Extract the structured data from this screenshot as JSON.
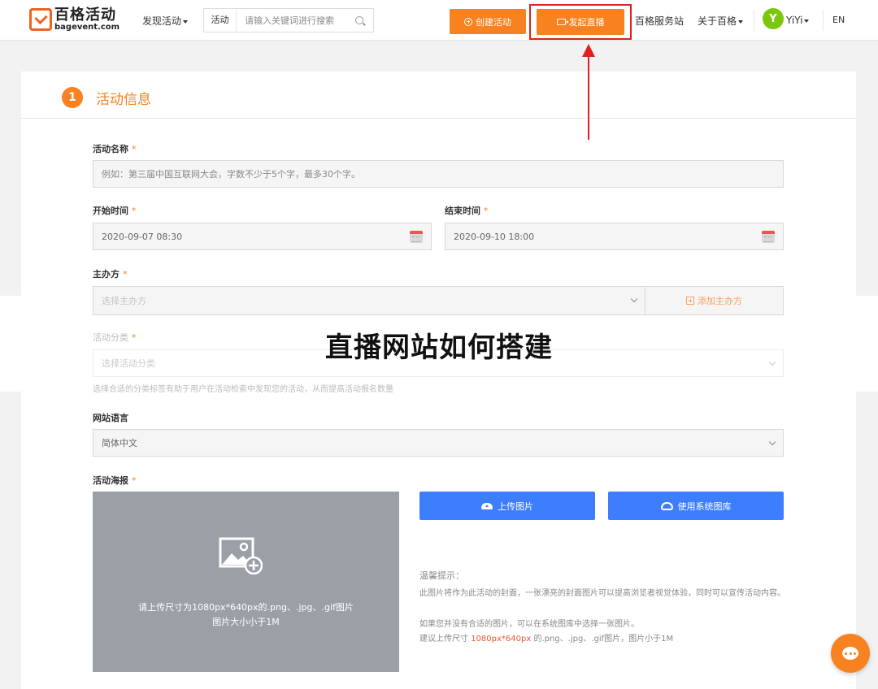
{
  "header": {
    "logo_cn": "百格活动",
    "logo_en": "bagevent.com",
    "discover": "发现活动",
    "search": {
      "type": "活动",
      "placeholder": "请输入关键词进行搜索"
    },
    "create_button": "创建活动",
    "live_button": "发起直播",
    "service": "百格服务站",
    "about": "关于百格",
    "avatar_letter": "Y",
    "username": "YiYi",
    "lang": "EN"
  },
  "section": {
    "step": "1",
    "title": "活动信息"
  },
  "form": {
    "name_label": "活动名称",
    "name_placeholder": "例如：第三届中国互联网大会，字数不少于5个字，最多30个字。",
    "start_label": "开始时间",
    "start_value": "2020-09-07 08:30",
    "end_label": "结束时间",
    "end_value": "2020-09-10 18:00",
    "host_label": "主办方",
    "host_placeholder": "选择主办方",
    "add_host": "添加主办方",
    "category_label": "活动分类",
    "category_placeholder": "选择活动分类",
    "category_hint": "选择合适的分类标签有助于用户在活动检索中发现您的活动，从而提高活动报名数量",
    "language_label": "网站语言",
    "language_value": "简体中文",
    "poster_label": "活动海报",
    "required_mark": "*"
  },
  "poster": {
    "line1": "请上传尺寸为1080px*640px的.png、.jpg、.gif图片",
    "line2": "图片大小小于1M",
    "upload_button": "上传图片",
    "gallery_button": "使用系统图库",
    "tips_title": "温馨提示：",
    "tip1": "此图片将作为此活动的封面，一张漂亮的封面图片可以提高浏览者视觉体验，同时可以宣传活动内容。",
    "tip2": "如果您并没有合适的图片，可以在系统图库中选择一张图片。",
    "tip3_prefix": "建议上传尺寸 ",
    "tip3_size": "1080px*640px",
    "tip3_suffix": " 的.png、.jpg、.gif图片，图片小于1M"
  },
  "overlay_title": "直播网站如何搭建",
  "colors": {
    "accent": "#f7821f",
    "primary_blue": "#3d7eff",
    "highlight_red": "#e02020"
  }
}
